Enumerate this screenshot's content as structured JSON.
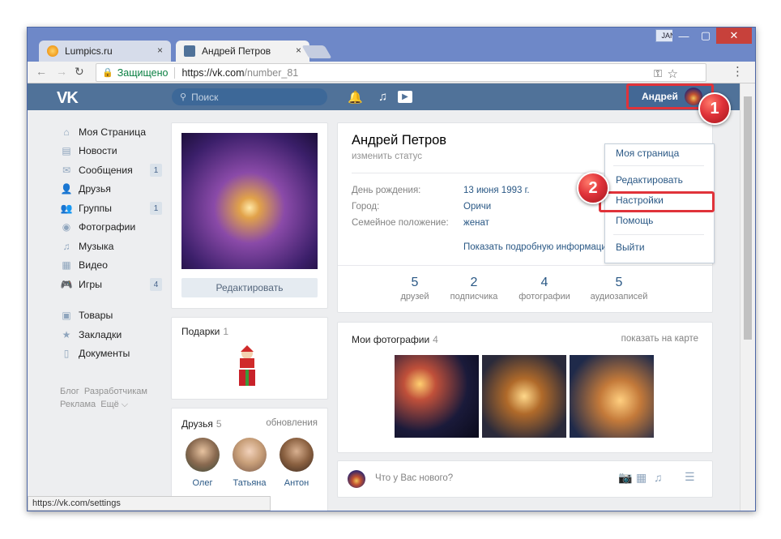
{
  "window": {
    "lang": "JAN",
    "controls": {
      "minimize": "—",
      "maximize": "▢",
      "close": "✕"
    }
  },
  "tabs": [
    {
      "title": "Lumpics.ru",
      "close": "×"
    },
    {
      "title": "Андрей Петров",
      "close": "×"
    }
  ],
  "address": {
    "secure_label": "Защищено",
    "url_host": "https://vk.com",
    "url_path": "/number_81"
  },
  "vk_header": {
    "logo": "VK",
    "search_placeholder": "Поиск",
    "user_name": "Андрей"
  },
  "sidebar": {
    "items": [
      {
        "label": "Моя Страница",
        "icon": "home-icon",
        "glyph": "⌂"
      },
      {
        "label": "Новости",
        "icon": "news-icon",
        "glyph": "▤"
      },
      {
        "label": "Сообщения",
        "icon": "messages-icon",
        "glyph": "✉",
        "badge": "1"
      },
      {
        "label": "Друзья",
        "icon": "friends-icon",
        "glyph": "👤"
      },
      {
        "label": "Группы",
        "icon": "groups-icon",
        "glyph": "👥",
        "badge": "1"
      },
      {
        "label": "Фотографии",
        "icon": "photos-icon",
        "glyph": "◉"
      },
      {
        "label": "Музыка",
        "icon": "music-icon",
        "glyph": "♫"
      },
      {
        "label": "Видео",
        "icon": "video-icon",
        "glyph": "▦"
      },
      {
        "label": "Игры",
        "icon": "games-icon",
        "glyph": "🎮",
        "badge": "4"
      },
      {
        "label": "Товары",
        "icon": "goods-icon",
        "glyph": "▣"
      },
      {
        "label": "Закладки",
        "icon": "bookmarks-icon",
        "glyph": "★"
      },
      {
        "label": "Документы",
        "icon": "documents-icon",
        "glyph": "▯"
      }
    ],
    "footer": {
      "blog": "Блог",
      "developers": "Разработчикам",
      "ads": "Реклама",
      "more": "Ещё ⌵"
    }
  },
  "profile_left": {
    "edit_button": "Редактировать",
    "gifts_title": "Подарки",
    "gifts_count": "1",
    "friends_title": "Друзья",
    "friends_count": "5",
    "friends_updates": "обновления",
    "friends": [
      {
        "name": "Олег"
      },
      {
        "name": "Татьяна"
      },
      {
        "name": "Антон"
      }
    ]
  },
  "profile": {
    "name": "Андрей Петров",
    "status": "изменить статус",
    "fields": [
      {
        "key": "День рождения:",
        "value": "13 июня 1993 г."
      },
      {
        "key": "Город:",
        "value": "Оричи"
      },
      {
        "key": "Семейное положение:",
        "value": "женат"
      }
    ],
    "more_link": "Показать подробную информацию",
    "stats": [
      {
        "n": "5",
        "label": "друзей"
      },
      {
        "n": "2",
        "label": "подписчика"
      },
      {
        "n": "4",
        "label": "фотографии"
      },
      {
        "n": "5",
        "label": "аудиозаписей"
      }
    ]
  },
  "photos": {
    "title": "Мои фотографии",
    "count": "4",
    "map_link": "показать на карте"
  },
  "post": {
    "placeholder": "Что у Вас нового?"
  },
  "dropdown": {
    "items": [
      "Моя страница",
      "Редактировать",
      "Настройки",
      "Помощь",
      "Выйти"
    ]
  },
  "callouts": {
    "one": "1",
    "two": "2"
  },
  "statusbar": "https://vk.com/settings",
  "colors": {
    "vk_blue": "#507299",
    "highlight_red": "#e0333a",
    "link": "#2a5885"
  }
}
